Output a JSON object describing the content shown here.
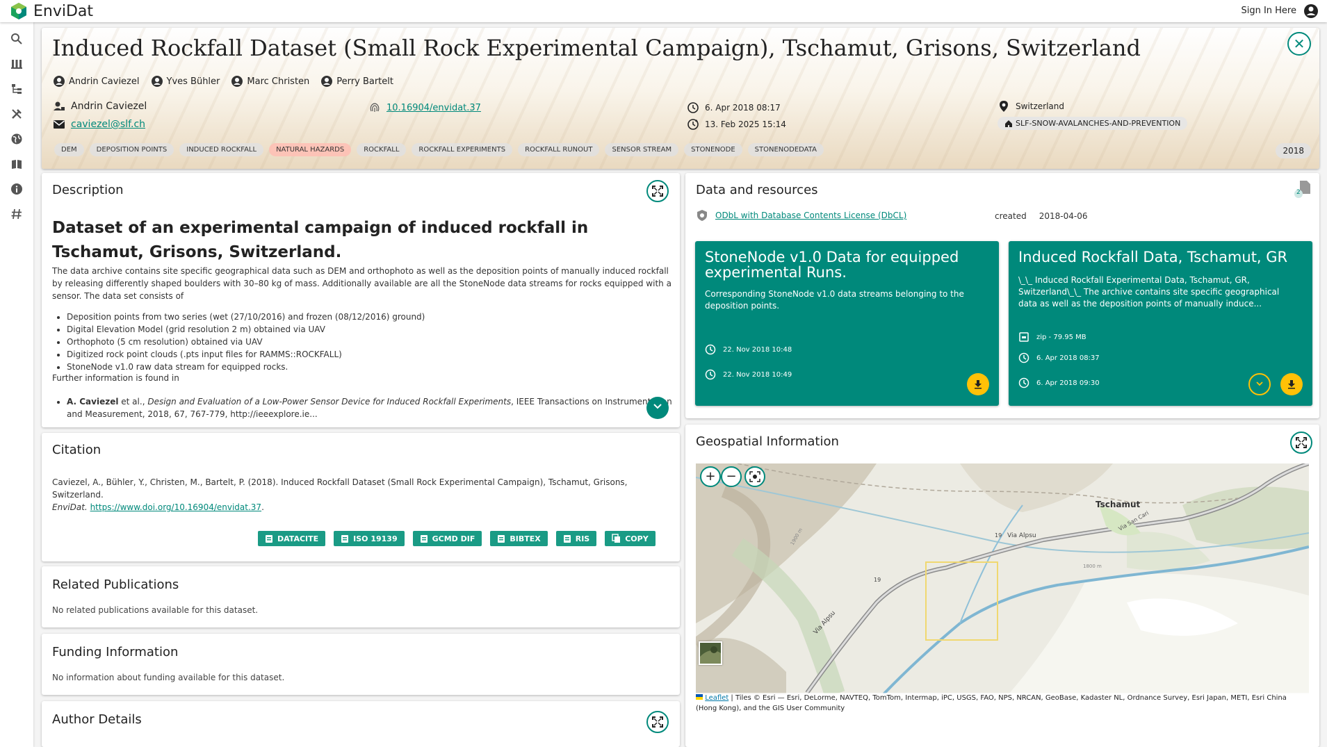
{
  "app": {
    "name": "EnviDat",
    "sign_in": "Sign In Here"
  },
  "nav": [
    "search-icon",
    "grid-icon",
    "tree-icon",
    "tools-icon",
    "globe-icon",
    "book-icon",
    "info-icon",
    "hash-icon"
  ],
  "header": {
    "title": "Induced Rockfall Dataset (Small Rock Experimental Campaign), Tschamut, Grisons, Switzerland",
    "authors": [
      "Andrin Caviezel",
      "Yves Bühler",
      "Marc Christen",
      "Perry Bartelt"
    ],
    "contact_name": "Andrin Caviezel",
    "contact_email": "caviezel@slf.ch",
    "doi": "10.16904/envidat.37",
    "created": "6. Apr 2018 08:17",
    "modified": "13. Feb 2025 15:14",
    "location": "Switzerland",
    "organization": "SLF-SNOW-AVALANCHES-AND-PREVENTION",
    "tags": [
      "DEM",
      "DEPOSITION POINTS",
      "INDUCED ROCKFALL",
      "NATURAL HAZARDS",
      "ROCKFALL",
      "ROCKFALL EXPERIMENTS",
      "ROCKFALL RUNOUT",
      "SENSOR STREAM",
      "STONENODE",
      "STONENODEDATA"
    ],
    "year": "2018"
  },
  "description": {
    "title": "Description",
    "heading": "Dataset of an experimental campaign of induced rockfall in Tschamut, Grisons, Switzerland.",
    "intro": "The data archive contains site specific geographical data such as DEM and orthophoto as well as the deposition points of manually induced rockfall by releasing differently shaped boulders with 30–80 kg of mass. Additionally available are all the StoneNode data streams for rocks equipped with a sensor. The data set consists of",
    "items": [
      "Deposition points from two series (wet (27/10/2016) and frozen (08/12/2016) ground)",
      "Digital Elevation Model (grid resolution 2 m) obtained via UAV",
      "Orthophoto (5 cm resolution) obtained via UAV",
      "Digitized rock point clouds (.pts input files for RAMMS::ROCKFALL)",
      "StoneNode v1.0 raw data stream for equipped rocks."
    ],
    "further": "Further information is found in",
    "ref_author": "A. Caviezel",
    "ref_etal": " et al., ",
    "ref_title": "Design and Evaluation of a Low-Power Sensor Device for Induced Rockfall Experiments",
    "ref_rest": ", IEEE Transactions on Instrumentation and Measurement, 2018, 67, 767-779, http://ieeexplore.ie..."
  },
  "citation": {
    "title": "Citation",
    "text": "Caviezel, A., Bühler, Y., Christen, M., Bartelt, P. (2018). Induced Rockfall Dataset (Small Rock Experimental Campaign), Tschamut, Grisons, Switzerland.",
    "source": "EnviDat.",
    "link": "https://www.doi.org/10.16904/envidat.37",
    "link_suffix": ".",
    "buttons": [
      "DATACITE",
      "ISO 19139",
      "GCMD DIF",
      "BIBTEX",
      "RIS",
      "COPY"
    ]
  },
  "related": {
    "title": "Related Publications",
    "text": "No related publications available for this dataset."
  },
  "funding": {
    "title": "Funding Information",
    "text": "No information about funding available for this dataset."
  },
  "author_details": {
    "title": "Author Details"
  },
  "resources": {
    "title": "Data and resources",
    "count": "2",
    "license": "ODbL with Database Contents License (DbCL)",
    "created_label": "created",
    "created_value": "2018-04-06",
    "items": [
      {
        "title": "StoneNode v1.0 Data for equipped experimental Runs.",
        "desc": "Corresponding StoneNode v1.0 data streams belonging to the deposition points.",
        "created": "22. Nov 2018 10:48",
        "modified": "22. Nov 2018 10:49"
      },
      {
        "title": "Induced Rockfall Data, Tschamut, GR",
        "desc": "\\_\\_ Induced Rockfall Experimental Data, Tschamut, GR, Switzerland\\_\\_ The archive contains site specific geographical data as well as the deposition points of manually induce...",
        "size": "zip - 79.95 MB",
        "created": "6. Apr 2018 08:37",
        "modified": "6. Apr 2018 09:30"
      }
    ]
  },
  "geo": {
    "title": "Geospatial Information",
    "labels": {
      "town": "Tschamut",
      "road1": "Via Alpsu",
      "road2": "Via Alpsu",
      "route": "19",
      "street": "Via San Cari",
      "contour1": "1800 m",
      "contour2": "1900 m"
    },
    "leaflet": "Leaflet",
    "attribution": " | Tiles © Esri — Esri, DeLorme, NAVTEQ, TomTom, Intermap, iPC, USGS, FAO, NPS, NRCAN, GeoBase, Kadaster NL, Ordnance Survey, Esri Japan, METI, Esri China (Hong Kong), and the GIS User Community"
  },
  "colors": {
    "primary": "#00897b",
    "accent": "#ffc107",
    "cite_button": "#1a9b85"
  }
}
